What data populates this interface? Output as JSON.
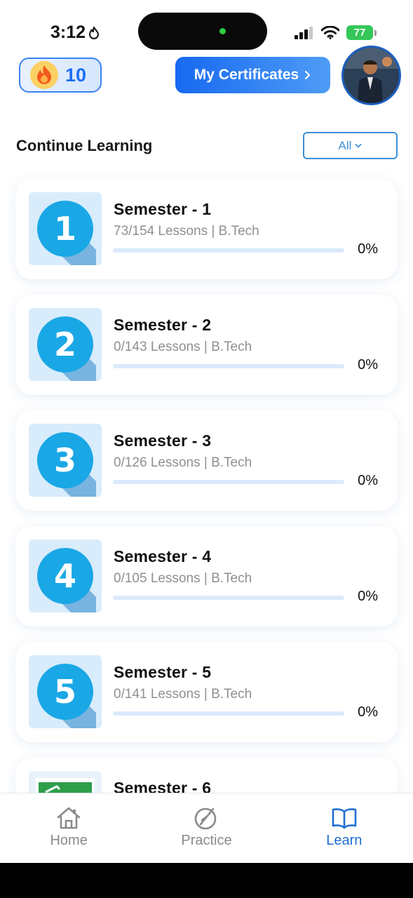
{
  "status": {
    "time": "3:12",
    "battery": "77"
  },
  "header": {
    "streak_count": "10",
    "certificates_label": "My Certificates"
  },
  "section": {
    "title": "Continue Learning",
    "filter_value": "All"
  },
  "semesters": [
    {
      "title": "Semester - 1",
      "subtitle": "73/154 Lessons | B.Tech",
      "percent": "0%",
      "progress": 0,
      "badge": "1"
    },
    {
      "title": "Semester - 2",
      "subtitle": "0/143 Lessons | B.Tech",
      "percent": "0%",
      "progress": 0,
      "badge": "2"
    },
    {
      "title": "Semester - 3",
      "subtitle": "0/126 Lessons | B.Tech",
      "percent": "0%",
      "progress": 0,
      "badge": "3"
    },
    {
      "title": "Semester - 4",
      "subtitle": "0/105 Lessons | B.Tech",
      "percent": "0%",
      "progress": 0,
      "badge": "4"
    },
    {
      "title": "Semester - 5",
      "subtitle": "0/141 Lessons | B.Tech",
      "percent": "0%",
      "progress": 0,
      "badge": "5"
    },
    {
      "title": "Semester - 6"
    }
  ],
  "nav": {
    "home": "Home",
    "practice": "Practice",
    "learn": "Learn",
    "active": "learn"
  },
  "colors": {
    "accent": "#1f6fd1",
    "badge_blue": "#1aa7e6",
    "card_bg": "#ffffff",
    "thumb_bg": "#d8ecfb"
  }
}
